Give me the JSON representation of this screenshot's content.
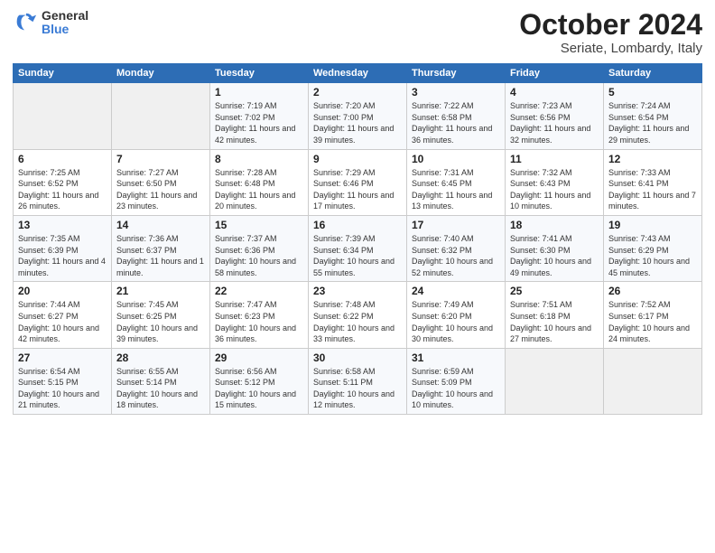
{
  "logo": {
    "general": "General",
    "blue": "Blue"
  },
  "header": {
    "title": "October 2024",
    "subtitle": "Seriate, Lombardy, Italy"
  },
  "days": [
    "Sunday",
    "Monday",
    "Tuesday",
    "Wednesday",
    "Thursday",
    "Friday",
    "Saturday"
  ],
  "weeks": [
    [
      {
        "day": "",
        "info": ""
      },
      {
        "day": "",
        "info": ""
      },
      {
        "day": "1",
        "info": "Sunrise: 7:19 AM\nSunset: 7:02 PM\nDaylight: 11 hours and 42 minutes."
      },
      {
        "day": "2",
        "info": "Sunrise: 7:20 AM\nSunset: 7:00 PM\nDaylight: 11 hours and 39 minutes."
      },
      {
        "day": "3",
        "info": "Sunrise: 7:22 AM\nSunset: 6:58 PM\nDaylight: 11 hours and 36 minutes."
      },
      {
        "day": "4",
        "info": "Sunrise: 7:23 AM\nSunset: 6:56 PM\nDaylight: 11 hours and 32 minutes."
      },
      {
        "day": "5",
        "info": "Sunrise: 7:24 AM\nSunset: 6:54 PM\nDaylight: 11 hours and 29 minutes."
      }
    ],
    [
      {
        "day": "6",
        "info": "Sunrise: 7:25 AM\nSunset: 6:52 PM\nDaylight: 11 hours and 26 minutes."
      },
      {
        "day": "7",
        "info": "Sunrise: 7:27 AM\nSunset: 6:50 PM\nDaylight: 11 hours and 23 minutes."
      },
      {
        "day": "8",
        "info": "Sunrise: 7:28 AM\nSunset: 6:48 PM\nDaylight: 11 hours and 20 minutes."
      },
      {
        "day": "9",
        "info": "Sunrise: 7:29 AM\nSunset: 6:46 PM\nDaylight: 11 hours and 17 minutes."
      },
      {
        "day": "10",
        "info": "Sunrise: 7:31 AM\nSunset: 6:45 PM\nDaylight: 11 hours and 13 minutes."
      },
      {
        "day": "11",
        "info": "Sunrise: 7:32 AM\nSunset: 6:43 PM\nDaylight: 11 hours and 10 minutes."
      },
      {
        "day": "12",
        "info": "Sunrise: 7:33 AM\nSunset: 6:41 PM\nDaylight: 11 hours and 7 minutes."
      }
    ],
    [
      {
        "day": "13",
        "info": "Sunrise: 7:35 AM\nSunset: 6:39 PM\nDaylight: 11 hours and 4 minutes."
      },
      {
        "day": "14",
        "info": "Sunrise: 7:36 AM\nSunset: 6:37 PM\nDaylight: 11 hours and 1 minute."
      },
      {
        "day": "15",
        "info": "Sunrise: 7:37 AM\nSunset: 6:36 PM\nDaylight: 10 hours and 58 minutes."
      },
      {
        "day": "16",
        "info": "Sunrise: 7:39 AM\nSunset: 6:34 PM\nDaylight: 10 hours and 55 minutes."
      },
      {
        "day": "17",
        "info": "Sunrise: 7:40 AM\nSunset: 6:32 PM\nDaylight: 10 hours and 52 minutes."
      },
      {
        "day": "18",
        "info": "Sunrise: 7:41 AM\nSunset: 6:30 PM\nDaylight: 10 hours and 49 minutes."
      },
      {
        "day": "19",
        "info": "Sunrise: 7:43 AM\nSunset: 6:29 PM\nDaylight: 10 hours and 45 minutes."
      }
    ],
    [
      {
        "day": "20",
        "info": "Sunrise: 7:44 AM\nSunset: 6:27 PM\nDaylight: 10 hours and 42 minutes."
      },
      {
        "day": "21",
        "info": "Sunrise: 7:45 AM\nSunset: 6:25 PM\nDaylight: 10 hours and 39 minutes."
      },
      {
        "day": "22",
        "info": "Sunrise: 7:47 AM\nSunset: 6:23 PM\nDaylight: 10 hours and 36 minutes."
      },
      {
        "day": "23",
        "info": "Sunrise: 7:48 AM\nSunset: 6:22 PM\nDaylight: 10 hours and 33 minutes."
      },
      {
        "day": "24",
        "info": "Sunrise: 7:49 AM\nSunset: 6:20 PM\nDaylight: 10 hours and 30 minutes."
      },
      {
        "day": "25",
        "info": "Sunrise: 7:51 AM\nSunset: 6:18 PM\nDaylight: 10 hours and 27 minutes."
      },
      {
        "day": "26",
        "info": "Sunrise: 7:52 AM\nSunset: 6:17 PM\nDaylight: 10 hours and 24 minutes."
      }
    ],
    [
      {
        "day": "27",
        "info": "Sunrise: 6:54 AM\nSunset: 5:15 PM\nDaylight: 10 hours and 21 minutes."
      },
      {
        "day": "28",
        "info": "Sunrise: 6:55 AM\nSunset: 5:14 PM\nDaylight: 10 hours and 18 minutes."
      },
      {
        "day": "29",
        "info": "Sunrise: 6:56 AM\nSunset: 5:12 PM\nDaylight: 10 hours and 15 minutes."
      },
      {
        "day": "30",
        "info": "Sunrise: 6:58 AM\nSunset: 5:11 PM\nDaylight: 10 hours and 12 minutes."
      },
      {
        "day": "31",
        "info": "Sunrise: 6:59 AM\nSunset: 5:09 PM\nDaylight: 10 hours and 10 minutes."
      },
      {
        "day": "",
        "info": ""
      },
      {
        "day": "",
        "info": ""
      }
    ]
  ]
}
